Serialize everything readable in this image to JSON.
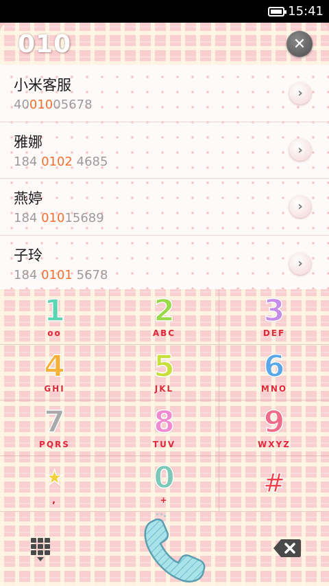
{
  "status_bar": {
    "time": "15:41",
    "battery_icon": "battery-full-icon"
  },
  "dialer": {
    "number": "010",
    "clear_icon": "close-icon"
  },
  "contacts": [
    {
      "name": "小米客服",
      "number_pre": "40",
      "number_hl": "010",
      "number_post": "05678"
    },
    {
      "name": "雅娜",
      "number_pre": "184 ",
      "number_hl": "0102",
      "number_post": " 4685"
    },
    {
      "name": "燕婷",
      "number_pre": "184 ",
      "number_hl": "010",
      "number_post": "15689"
    },
    {
      "name": "子玲",
      "number_pre": "184 ",
      "number_hl": "0101",
      "number_post": " 5678"
    }
  ],
  "keypad": [
    {
      "digit": "1",
      "letters": "oo",
      "color": "#5cd6b0"
    },
    {
      "digit": "2",
      "letters": "ABC",
      "color": "#9ad94a"
    },
    {
      "digit": "3",
      "letters": "DEF",
      "color": "#c58de8"
    },
    {
      "digit": "4",
      "letters": "GHI",
      "color": "#f5b23a"
    },
    {
      "digit": "5",
      "letters": "JKL",
      "color": "#c9df3c"
    },
    {
      "digit": "6",
      "letters": "MNO",
      "color": "#5aa8e8"
    },
    {
      "digit": "7",
      "letters": "PQRS",
      "color": "#a9a9a9"
    },
    {
      "digit": "8",
      "letters": "TUV",
      "color": "#f08ad0"
    },
    {
      "digit": "9",
      "letters": "WXYZ",
      "color": "#f06a8a"
    },
    {
      "digit": "★",
      "letters": ",",
      "color": "#f5cf3a"
    },
    {
      "digit": "0",
      "letters": "+",
      "color": "#7cc9b8"
    },
    {
      "digit": "#",
      "letters": "",
      "color": "#f0404a"
    }
  ],
  "bottom_bar": {
    "dialpad_icon": "dialpad-toggle-icon",
    "call_icon": "phone-handset-icon",
    "backspace_icon": "backspace-icon"
  },
  "colors": {
    "highlight": "#f07030",
    "plaid_pink": "#f9cfcf",
    "plaid_cream": "#fff8e6",
    "key_letters": "#e0283a"
  }
}
